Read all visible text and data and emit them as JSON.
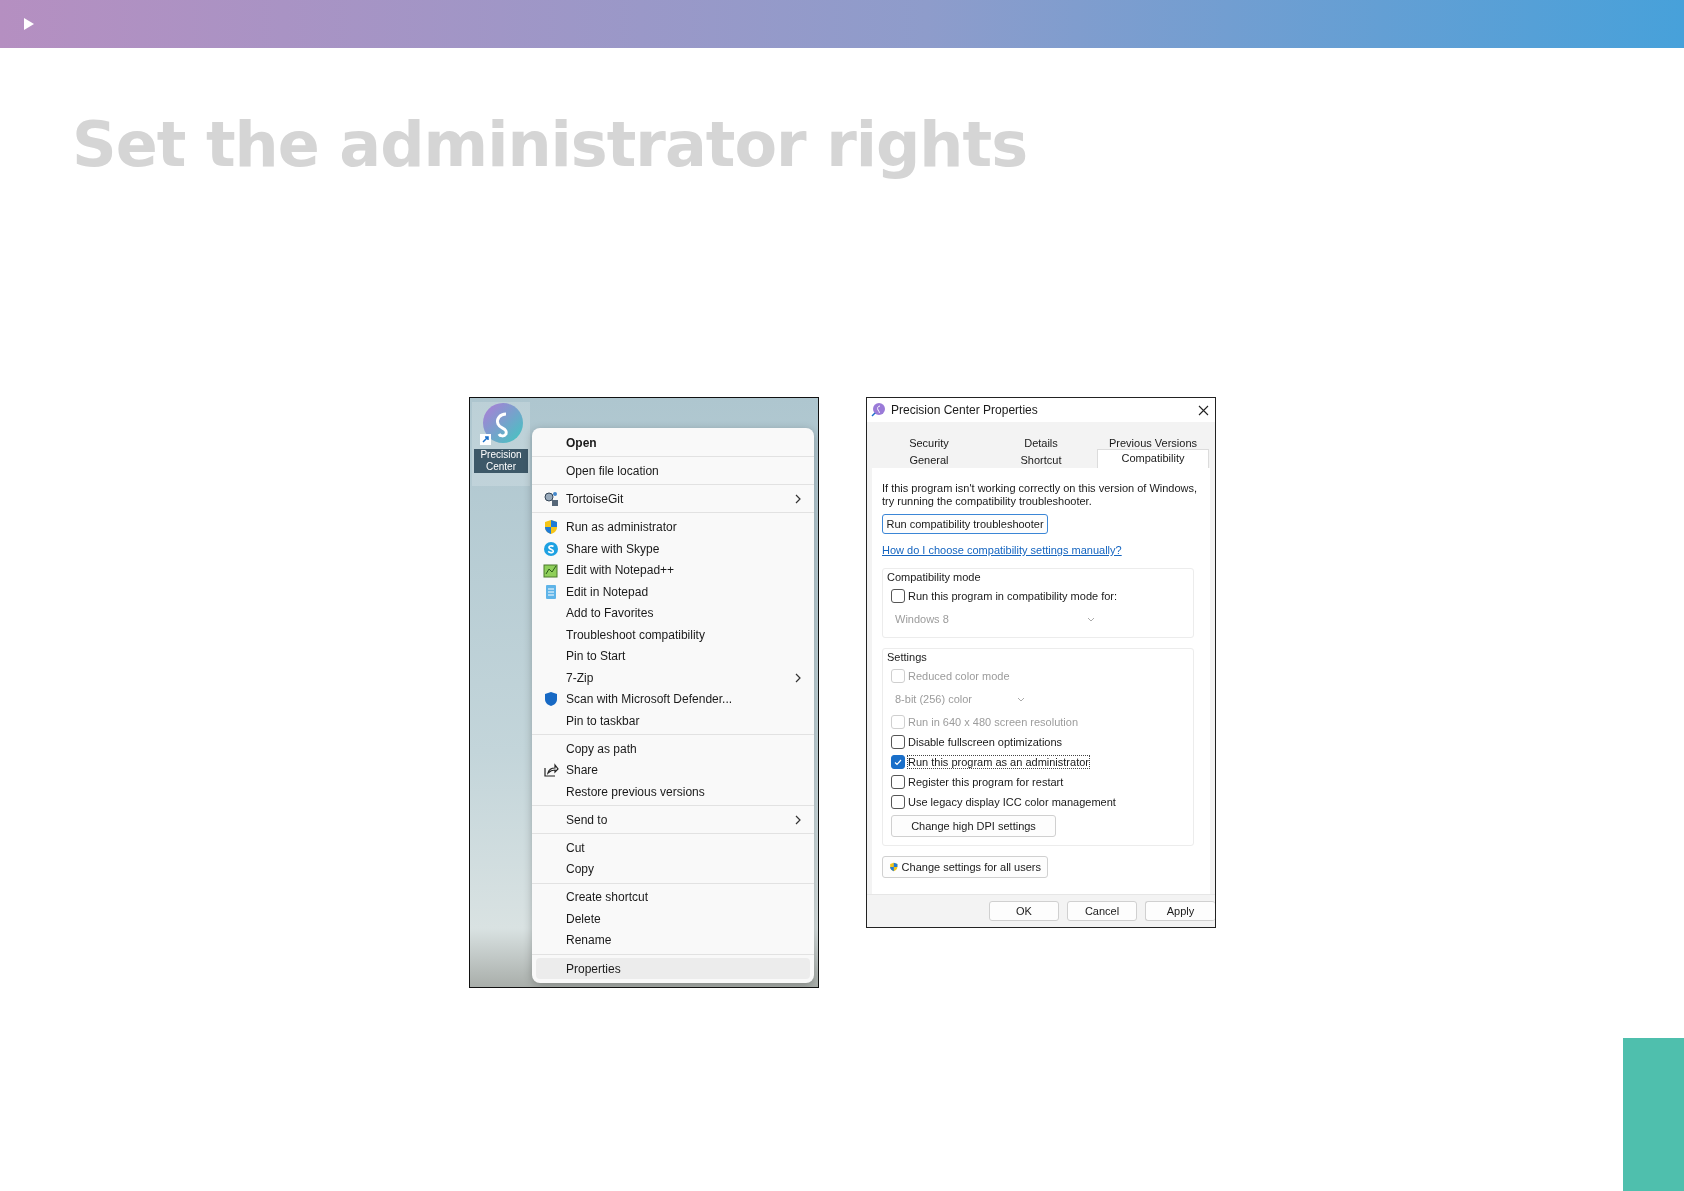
{
  "slide": {
    "title": "Set the administrator rights"
  },
  "desktop": {
    "shortcut_label": "Precision Center",
    "context_menu": {
      "groups": [
        [
          {
            "label": "Open",
            "kind": "default",
            "submenu": false,
            "selected": false
          }
        ],
        [
          {
            "label": "Open file location",
            "kind": "command",
            "submenu": false,
            "selected": false
          }
        ],
        [
          {
            "label": "TortoiseGit",
            "kind": "command",
            "submenu": true,
            "selected": false
          }
        ],
        [
          {
            "label": "Run as administrator",
            "kind": "command",
            "submenu": false,
            "selected": false
          },
          {
            "label": "Share with Skype",
            "kind": "command",
            "submenu": false,
            "selected": false
          },
          {
            "label": "Edit with Notepad++",
            "kind": "command",
            "submenu": false,
            "selected": false
          },
          {
            "label": "Edit in Notepad",
            "kind": "command",
            "submenu": false,
            "selected": false
          },
          {
            "label": "Add to Favorites",
            "kind": "command",
            "submenu": false,
            "selected": false
          },
          {
            "label": "Troubleshoot compatibility",
            "kind": "command",
            "submenu": false,
            "selected": false
          },
          {
            "label": "Pin to Start",
            "kind": "command",
            "submenu": false,
            "selected": false
          },
          {
            "label": "7-Zip",
            "kind": "command",
            "submenu": true,
            "selected": false
          },
          {
            "label": "Scan with Microsoft Defender...",
            "kind": "command",
            "submenu": false,
            "selected": false
          },
          {
            "label": "Pin to taskbar",
            "kind": "command",
            "submenu": false,
            "selected": false
          }
        ],
        [
          {
            "label": "Copy as path",
            "kind": "command",
            "submenu": false,
            "selected": false
          },
          {
            "label": "Share",
            "kind": "command",
            "submenu": false,
            "selected": false
          },
          {
            "label": "Restore previous versions",
            "kind": "command",
            "submenu": false,
            "selected": false
          }
        ],
        [
          {
            "label": "Send to",
            "kind": "command",
            "submenu": true,
            "selected": false
          }
        ],
        [
          {
            "label": "Cut",
            "kind": "command",
            "submenu": false,
            "selected": false
          },
          {
            "label": "Copy",
            "kind": "command",
            "submenu": false,
            "selected": false
          }
        ],
        [
          {
            "label": "Create shortcut",
            "kind": "command",
            "submenu": false,
            "selected": false
          },
          {
            "label": "Delete",
            "kind": "command",
            "submenu": false,
            "selected": false
          },
          {
            "label": "Rename",
            "kind": "command",
            "submenu": false,
            "selected": false
          }
        ],
        [
          {
            "label": "Properties",
            "kind": "command",
            "submenu": false,
            "selected": true
          }
        ]
      ]
    }
  },
  "dialog": {
    "title": "Precision Center Properties",
    "tab_rows": [
      [
        {
          "label": "Security",
          "selected": false
        },
        {
          "label": "Details",
          "selected": false
        },
        {
          "label": "Previous Versions",
          "selected": false
        }
      ],
      [
        {
          "label": "General",
          "selected": false
        },
        {
          "label": "Shortcut",
          "selected": false
        },
        {
          "label": "Compatibility",
          "selected": true
        }
      ]
    ],
    "intro": "If this program isn't working correctly on this version of Windows, try running the compatibility troubleshooter.",
    "troubleshooter_button": "Run compatibility troubleshooter",
    "help_link": "How do I choose compatibility settings manually?",
    "compatibility_mode": {
      "label": "Compatibility mode",
      "items": [
        {
          "kind": "checkbox",
          "label": "Run this program in compatibility mode for:",
          "checked": false,
          "disabled": false,
          "focused": false
        },
        {
          "kind": "dropdown",
          "value": "Windows 8",
          "disabled": true
        }
      ]
    },
    "settings": {
      "label": "Settings",
      "items": [
        {
          "kind": "checkbox",
          "label": "Reduced color mode",
          "checked": false,
          "disabled": true,
          "focused": false
        },
        {
          "kind": "dropdown",
          "value": "8-bit (256) color",
          "disabled": true
        },
        {
          "kind": "checkbox",
          "label": "Run in 640 x 480 screen resolution",
          "checked": false,
          "disabled": true,
          "focused": false
        },
        {
          "kind": "checkbox",
          "label": "Disable fullscreen optimizations",
          "checked": false,
          "disabled": false,
          "focused": false
        },
        {
          "kind": "checkbox",
          "label": "Run this program as an administrator",
          "checked": true,
          "disabled": false,
          "focused": true
        },
        {
          "kind": "checkbox",
          "label": "Register this program for restart",
          "checked": false,
          "disabled": false,
          "focused": false
        },
        {
          "kind": "checkbox",
          "label": "Use legacy display ICC color management",
          "checked": false,
          "disabled": false,
          "focused": false
        },
        {
          "kind": "button",
          "label": "Change high DPI settings"
        }
      ]
    },
    "all_users_button": "Change settings for all users",
    "buttons": [
      "OK",
      "Cancel",
      "Apply"
    ]
  }
}
